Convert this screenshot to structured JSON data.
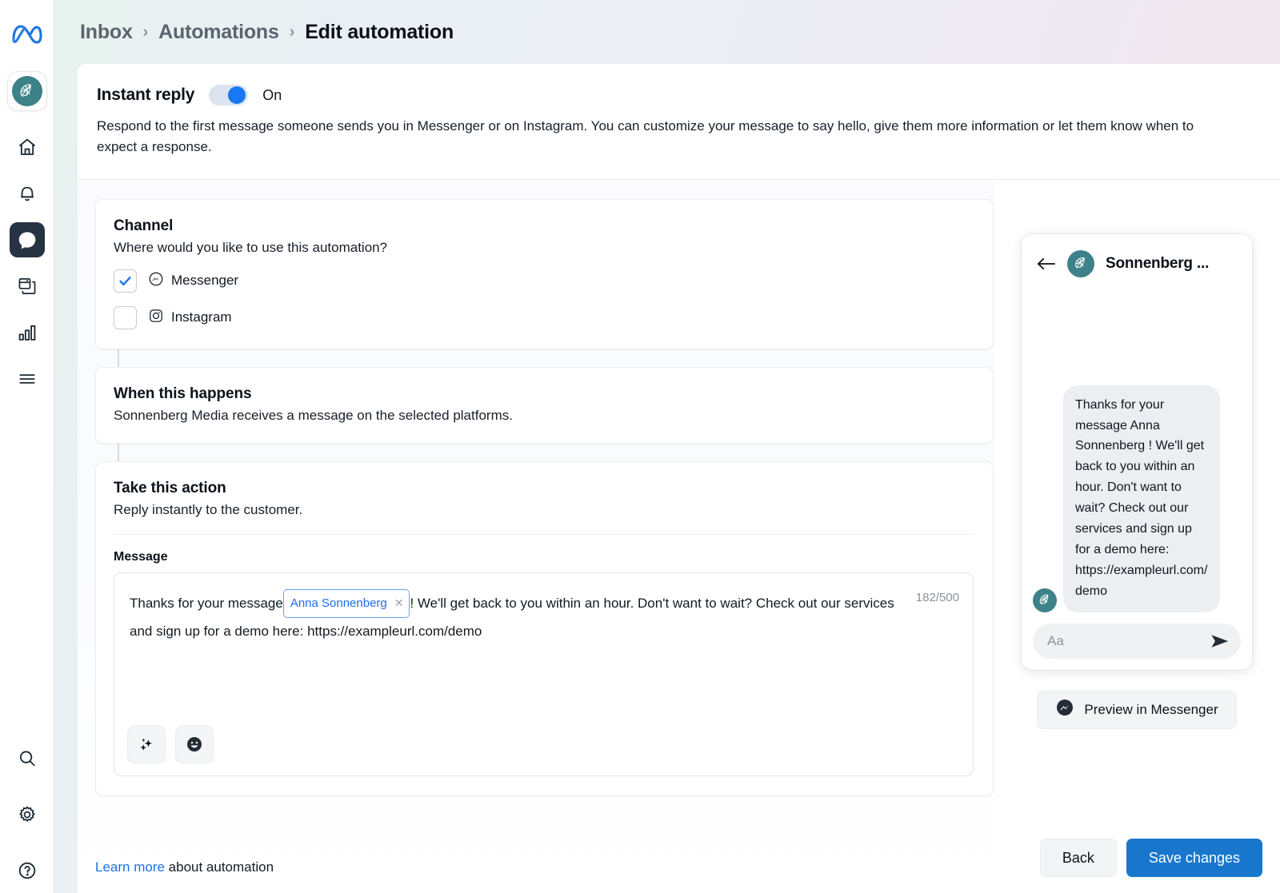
{
  "breadcrumb": {
    "items": [
      "Inbox",
      "Automations",
      "Edit automation"
    ],
    "separator": "›"
  },
  "instant_reply": {
    "title": "Instant reply",
    "toggle_state": "On",
    "toggle_on": true,
    "description": "Respond to the first message someone sends you in Messenger or on Instagram. You can customize your message to say hello, give them more information or let them know when to expect a response."
  },
  "channel": {
    "title": "Channel",
    "subtitle": "Where would you like to use this automation?",
    "options": [
      {
        "label": "Messenger",
        "icon": "messenger-icon",
        "checked": true
      },
      {
        "label": "Instagram",
        "icon": "instagram-icon",
        "checked": false
      }
    ]
  },
  "trigger": {
    "title": "When this happens",
    "subtitle": "Sonnenberg Media receives a message on the selected platforms."
  },
  "action": {
    "title": "Take this action",
    "subtitle": "Reply instantly to the customer.",
    "message_label": "Message",
    "message_prefix": "Thanks for your message",
    "message_token": "Anna Sonnenberg",
    "message_token_remove": "✕",
    "message_suffix": "! We'll get back to you within an hour. Don't want to wait? Check out our services and sign up for a demo here: https://exampleurl.com/demo",
    "counter": "182/500",
    "tools": [
      {
        "name": "ai-sparkle-button",
        "glyph": "sparkle"
      },
      {
        "name": "emoji-button",
        "glyph": "emoji"
      }
    ]
  },
  "learn_more": {
    "link_text": "Learn more",
    "rest_text": " about automation"
  },
  "preview": {
    "back_icon": "back-arrow-icon",
    "contact_name": "Sonnenberg ...",
    "bubble_text": "Thanks for your message Anna Sonnenberg ! We'll get back to you within an hour. Don't want to wait? Check out our services and sign up for a demo here: https://exampleurl.com/demo",
    "input_placeholder": "Aa",
    "send_icon": "send-icon",
    "preview_button_label": "Preview in Messenger"
  },
  "footer": {
    "back_label": "Back",
    "save_label": "Save changes"
  },
  "colors": {
    "brand_teal": "#3d8288",
    "primary_blue": "#1877cd",
    "link_blue": "#1b74e4",
    "toggle_blue": "#1877f2",
    "token_blue": "#1b6ef3",
    "rail_active": "#253342",
    "bubble_gray": "#eceef1"
  },
  "rail": {
    "logo": "meta-logo-icon",
    "brand": "sonnenberg-brand-avatar",
    "items": [
      {
        "name": "home-icon",
        "active": false
      },
      {
        "name": "bell-icon",
        "active": false
      },
      {
        "name": "chat-bubble-icon",
        "active": true
      },
      {
        "name": "pages-icon",
        "active": false
      },
      {
        "name": "bar-chart-icon",
        "active": false
      },
      {
        "name": "hamburger-menu-icon",
        "active": false
      }
    ],
    "bottom_items": [
      {
        "name": "search-icon"
      },
      {
        "name": "gear-icon"
      },
      {
        "name": "help-circle-icon"
      }
    ]
  }
}
